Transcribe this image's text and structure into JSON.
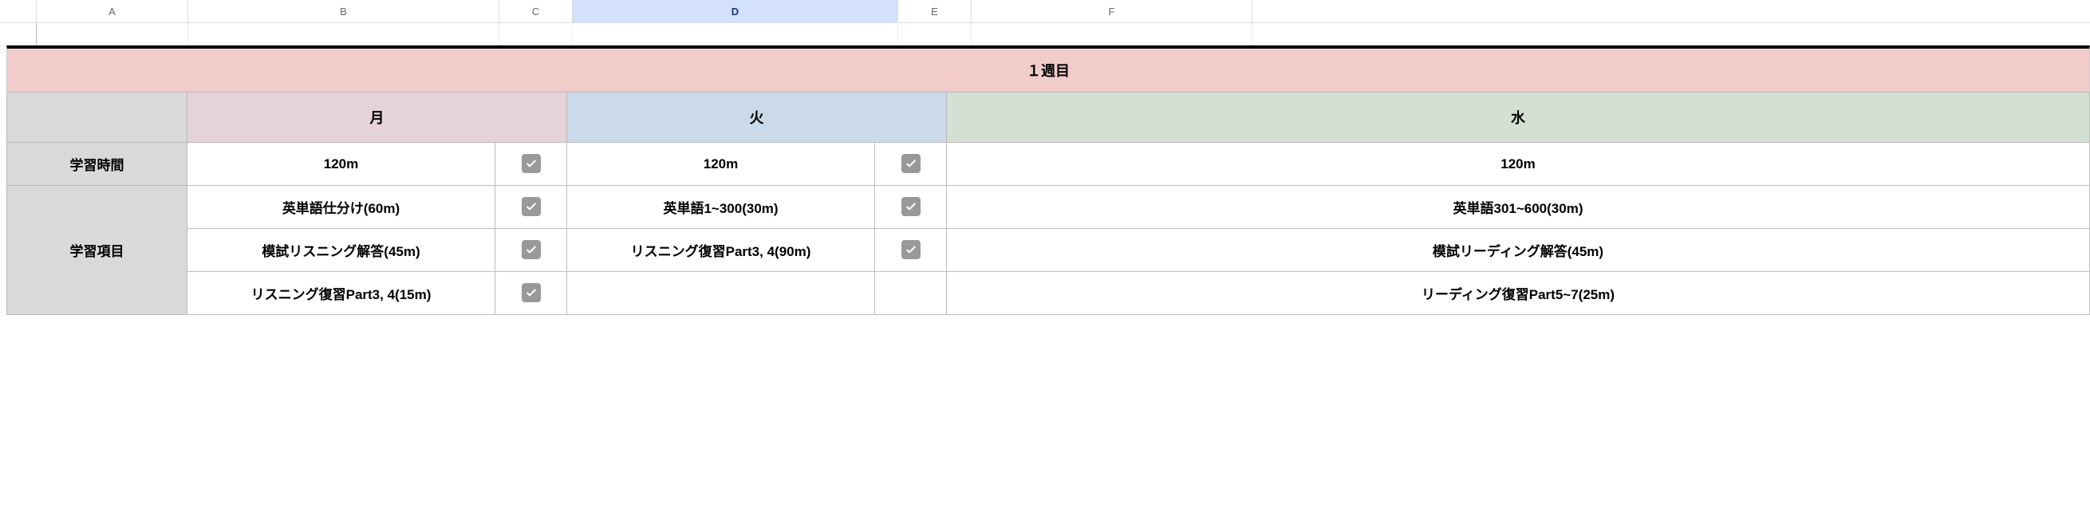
{
  "columns": {
    "A": "A",
    "B": "B",
    "C": "C",
    "D": "D",
    "E": "E",
    "F": "F"
  },
  "week_label": "１週目",
  "day_headers": {
    "mon": "月",
    "tue": "火",
    "wed": "水"
  },
  "row_labels": {
    "study_time": "学習時間",
    "study_items": "学習項目"
  },
  "study_time": {
    "mon": "120m",
    "tue": "120m",
    "wed": "120m"
  },
  "items": {
    "mon": [
      "英単語仕分け(60m)",
      "模試リスニング解答(45m)",
      "リスニング復習Part3, 4(15m)"
    ],
    "tue": [
      "英単語1~300(30m)",
      "リスニング復習Part3, 4(90m)",
      ""
    ],
    "wed": [
      "英単語301~600(30m)",
      "模試リーディング解答(45m)",
      "リーディング復習Part5~7(25m)"
    ]
  },
  "checks": {
    "time_mon": true,
    "time_tue": true,
    "item_mon_0": true,
    "item_mon_1": true,
    "item_mon_2": true,
    "item_tue_0": true,
    "item_tue_1": true
  }
}
